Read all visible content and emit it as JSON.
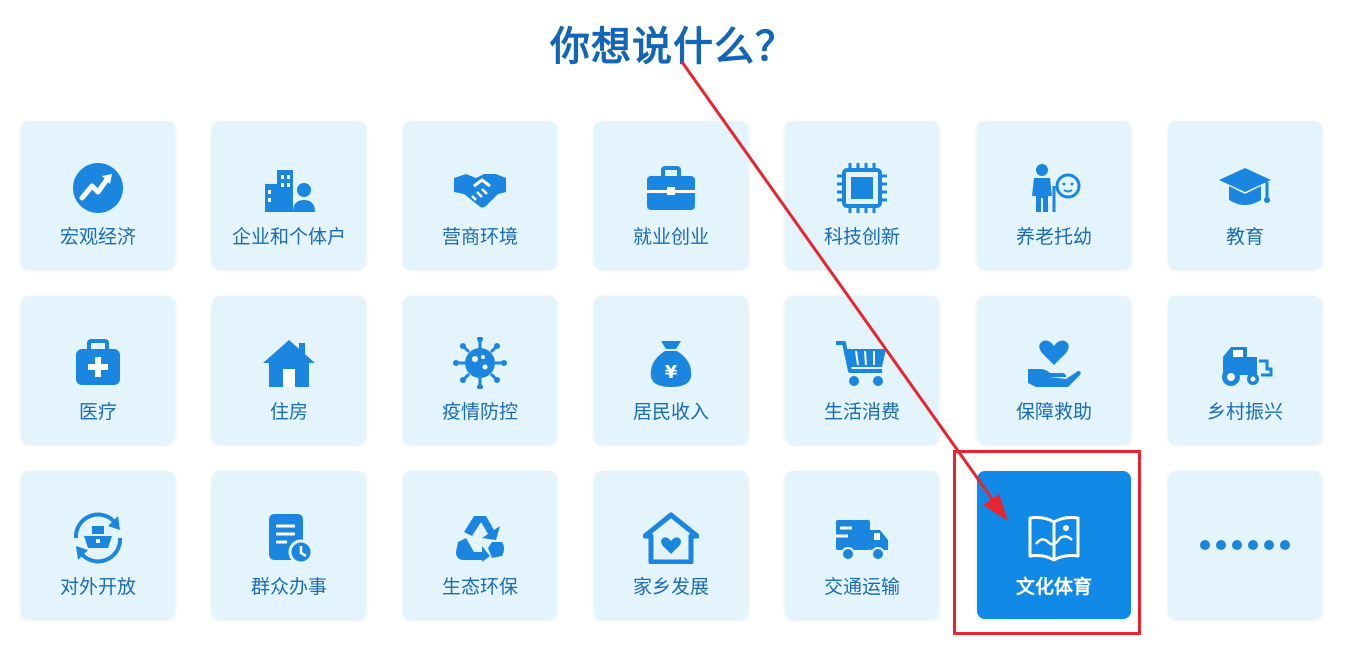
{
  "header": {
    "title": "你想说什么？"
  },
  "colors": {
    "tile_bg": "#e3f4fd",
    "icon_blue": "#1a86e0",
    "label_blue": "#1b6bb5",
    "title_blue": "#1266b5",
    "active_bg": "#1189e6",
    "highlight_red": "#e8242f"
  },
  "categories": [
    {
      "label": "宏观经济",
      "icon": "trend-up-icon"
    },
    {
      "label": "企业和个体户",
      "icon": "buildings-person-icon"
    },
    {
      "label": "营商环境",
      "icon": "handshake-icon"
    },
    {
      "label": "就业创业",
      "icon": "briefcase-icon"
    },
    {
      "label": "科技创新",
      "icon": "chip-icon"
    },
    {
      "label": "养老托幼",
      "icon": "elder-child-icon"
    },
    {
      "label": "教育",
      "icon": "graduation-cap-icon"
    },
    {
      "label": "医疗",
      "icon": "medical-kit-icon"
    },
    {
      "label": "住房",
      "icon": "house-icon"
    },
    {
      "label": "疫情防控",
      "icon": "virus-icon"
    },
    {
      "label": "居民收入",
      "icon": "money-bag-icon"
    },
    {
      "label": "生活消费",
      "icon": "shopping-cart-icon"
    },
    {
      "label": "保障救助",
      "icon": "hand-heart-icon"
    },
    {
      "label": "乡村振兴",
      "icon": "tractor-icon"
    },
    {
      "label": "对外开放",
      "icon": "ship-cycle-icon"
    },
    {
      "label": "群众办事",
      "icon": "document-clock-icon"
    },
    {
      "label": "生态环保",
      "icon": "recycle-icon"
    },
    {
      "label": "家乡发展",
      "icon": "home-heart-icon"
    },
    {
      "label": "交通运输",
      "icon": "truck-icon"
    },
    {
      "label": "文化体育",
      "icon": "open-book-icon",
      "selected": true
    },
    {
      "label": "",
      "icon": "more-dots-icon"
    }
  ]
}
